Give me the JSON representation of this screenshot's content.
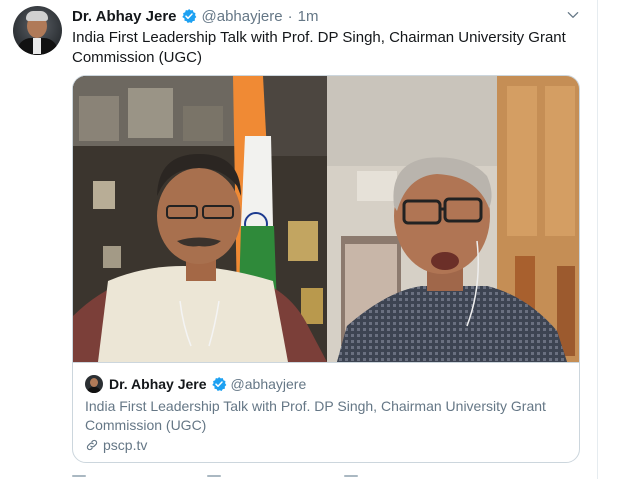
{
  "tweet": {
    "author_name": "Dr. Abhay Jere",
    "author_handle": "@abhayjere",
    "separator": "·",
    "timestamp": "1m",
    "text": "India First Leadership Talk with Prof. DP Singh, Chairman University Grant Commission (UGC)"
  },
  "card": {
    "author_name": "Dr. Abhay Jere",
    "author_handle": "@abhayjere",
    "text": "India First Leadership Talk with Prof. DP Singh, Chairman University Grant Commission (UGC)",
    "link_domain": "pscp.tv"
  },
  "icons": {
    "verified": "verified-badge-icon",
    "menu": "chevron-down-icon",
    "link": "link-icon"
  },
  "colors": {
    "accent": "#1da1f2",
    "muted": "#657786",
    "text": "#14171a",
    "border": "#ccd6dd"
  }
}
